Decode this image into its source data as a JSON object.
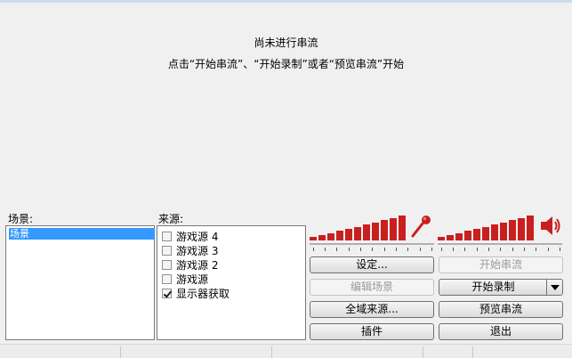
{
  "preview": {
    "line1": "尚未进行串流",
    "line2": "点击“开始串流”、“开始录制”或者“预览串流”开始"
  },
  "scenes": {
    "label": "场景:",
    "items": [
      "场景"
    ]
  },
  "sources": {
    "label": "来源:",
    "items": [
      {
        "name": "游戏源 4",
        "checked": false
      },
      {
        "name": "游戏源 3",
        "checked": false
      },
      {
        "name": "游戏源 2",
        "checked": false
      },
      {
        "name": "游戏源",
        "checked": false
      },
      {
        "name": "显示器获取",
        "checked": true
      }
    ]
  },
  "buttons": {
    "settings": "设定...",
    "edit_scene": "编辑场景",
    "global_sources": "全域来源...",
    "plugins": "插件",
    "start_stream": "开始串流",
    "start_record": "开始录制",
    "preview_stream": "预览串流",
    "exit": "退出"
  },
  "colors": {
    "meter": "#c8201f",
    "selection": "#3399ff"
  },
  "icons": {
    "mic": "microphone-icon",
    "speaker": "speaker-icon"
  }
}
